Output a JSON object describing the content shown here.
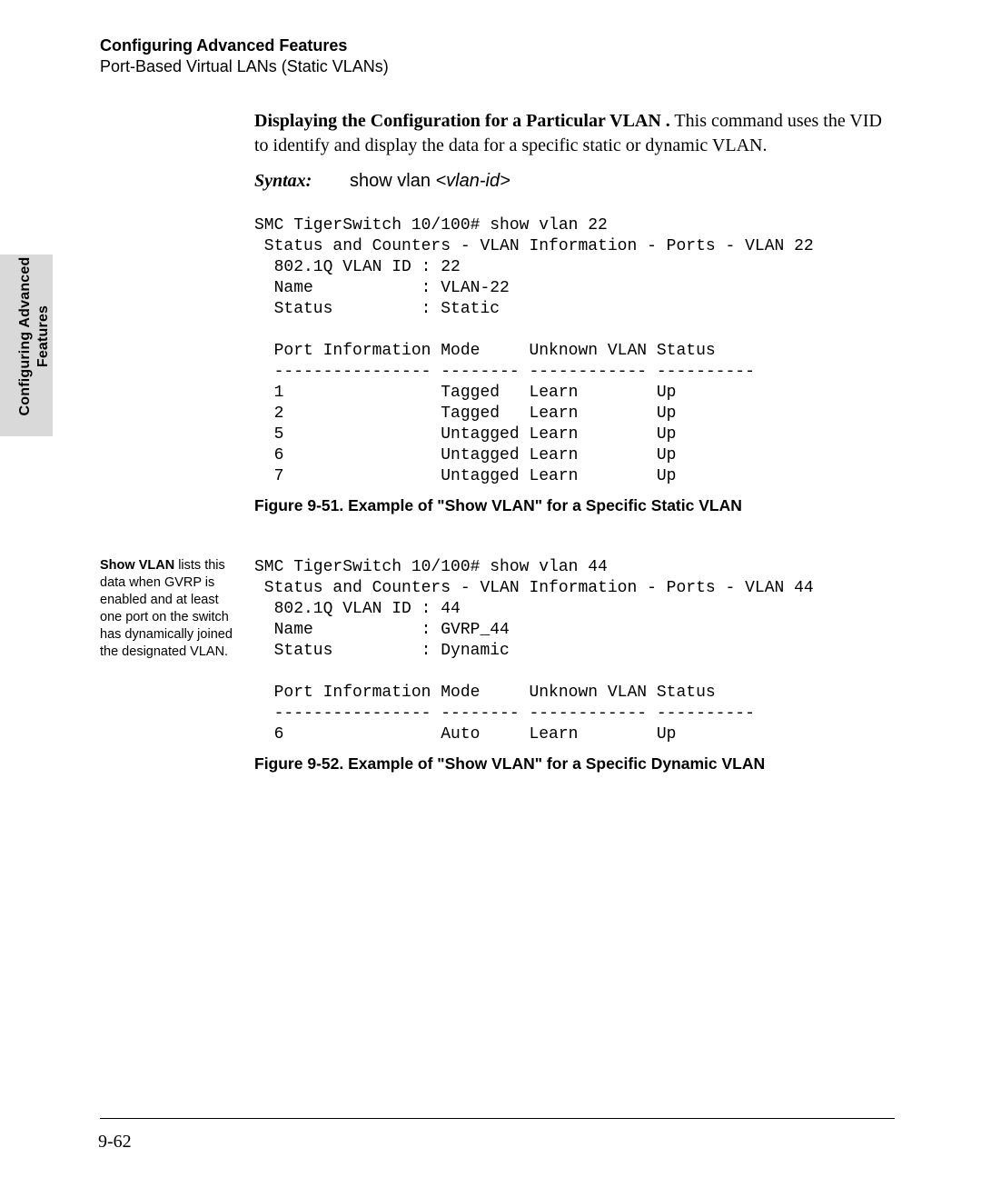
{
  "header": {
    "title": "Configuring Advanced Features",
    "subtitle": "Port-Based Virtual LANs (Static VLANs)"
  },
  "side_tab": {
    "line1": "Configuring Advanced",
    "line2": "Features"
  },
  "intro": {
    "lead": "Displaying the Configuration for a Particular VLAN .",
    "rest": "  This command uses the VID to identify and display the data for a specific static or dynamic VLAN."
  },
  "syntax": {
    "label": "Syntax:",
    "cmd_prefix": "show vlan ",
    "cmd_arg": "<vlan-id>"
  },
  "fig1": {
    "terminal": "SMC TigerSwitch 10/100# show vlan 22\n Status and Counters - VLAN Information - Ports - VLAN 22\n  802.1Q VLAN ID : 22\n  Name           : VLAN-22\n  Status         : Static\n\n  Port Information Mode     Unknown VLAN Status\n  ---------------- -------- ------------ ----------\n  1                Tagged   Learn        Up\n  2                Tagged   Learn        Up\n  5                Untagged Learn        Up\n  6                Untagged Learn        Up\n  7                Untagged Learn        Up",
    "caption": "Figure 9-51.  Example of \"Show VLAN\" for a Specific Static VLAN"
  },
  "fig2": {
    "note_bold": "Show VLAN",
    "note_rest": " lists this data when GVRP is enabled and at least one port on the switch has dynamically joined the designated VLAN.",
    "terminal": "SMC TigerSwitch 10/100# show vlan 44\n Status and Counters - VLAN Information - Ports - VLAN 44\n  802.1Q VLAN ID : 44\n  Name           : GVRP_44\n  Status         : Dynamic\n\n  Port Information Mode     Unknown VLAN Status\n  ---------------- -------- ------------ ----------\n  6                Auto     Learn        Up",
    "caption": "Figure 9-52.  Example of \"Show VLAN\" for a Specific Dynamic VLAN"
  },
  "page_number": "9-62",
  "chart_data": {
    "type": "table",
    "tables": [
      {
        "title": "show vlan 22",
        "meta": {
          "802.1Q VLAN ID": 22,
          "Name": "VLAN-22",
          "Status": "Static"
        },
        "columns": [
          "Port Information",
          "Mode",
          "Unknown VLAN",
          "Status"
        ],
        "rows": [
          [
            "1",
            "Tagged",
            "Learn",
            "Up"
          ],
          [
            "2",
            "Tagged",
            "Learn",
            "Up"
          ],
          [
            "5",
            "Untagged",
            "Learn",
            "Up"
          ],
          [
            "6",
            "Untagged",
            "Learn",
            "Up"
          ],
          [
            "7",
            "Untagged",
            "Learn",
            "Up"
          ]
        ]
      },
      {
        "title": "show vlan 44",
        "meta": {
          "802.1Q VLAN ID": 44,
          "Name": "GVRP_44",
          "Status": "Dynamic"
        },
        "columns": [
          "Port Information",
          "Mode",
          "Unknown VLAN",
          "Status"
        ],
        "rows": [
          [
            "6",
            "Auto",
            "Learn",
            "Up"
          ]
        ]
      }
    ]
  }
}
